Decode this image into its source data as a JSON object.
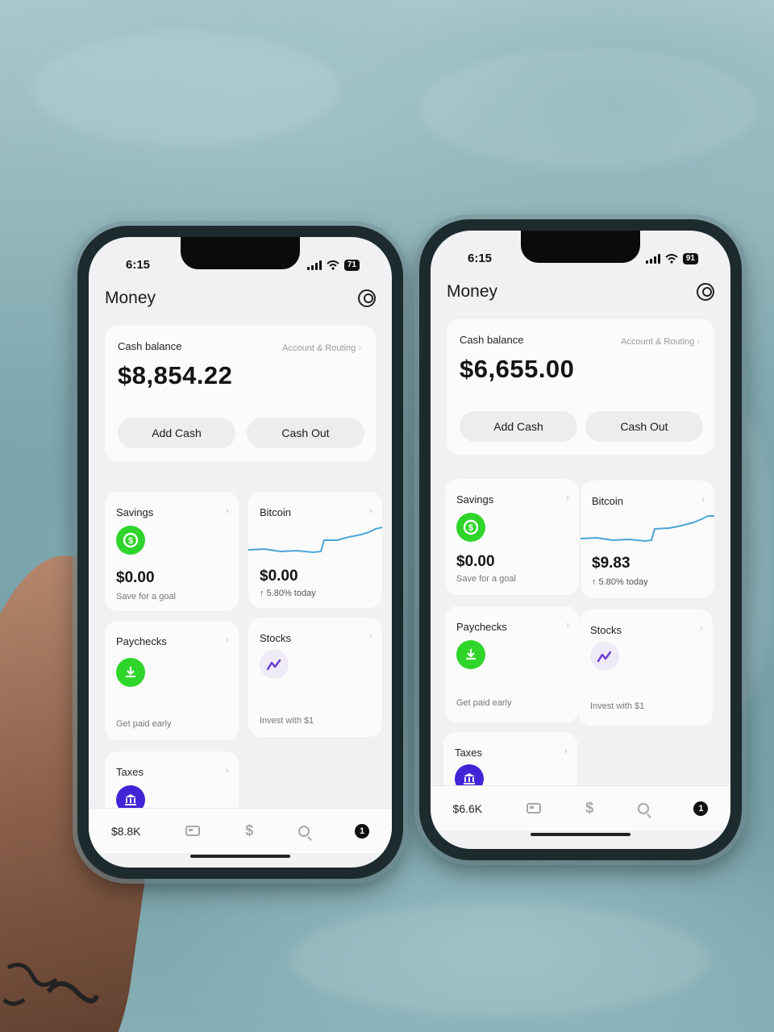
{
  "phones": [
    {
      "status": {
        "time": "6:15",
        "battery": "71"
      },
      "header": {
        "title": "Money"
      },
      "cash": {
        "label": "Cash balance",
        "account_link": "Account & Routing",
        "amount": "$8,854.22",
        "add_label": "Add Cash",
        "out_label": "Cash Out"
      },
      "savings": {
        "title": "Savings",
        "amount": "$0.00",
        "subtitle": "Save for a goal"
      },
      "bitcoin": {
        "title": "Bitcoin",
        "amount": "$0.00",
        "change": "↑ 5.80% today"
      },
      "paychecks": {
        "title": "Paychecks",
        "subtitle": "Get paid early"
      },
      "stocks": {
        "title": "Stocks",
        "subtitle": "Invest with $1"
      },
      "taxes": {
        "title": "Taxes"
      },
      "tabbar": {
        "balance": "$8.8K",
        "dollar": "$",
        "activity_count": "1"
      }
    },
    {
      "status": {
        "time": "6:15",
        "battery": "91"
      },
      "header": {
        "title": "Money"
      },
      "cash": {
        "label": "Cash balance",
        "account_link": "Account & Routing",
        "amount": "$6,655.00",
        "add_label": "Add Cash",
        "out_label": "Cash Out"
      },
      "savings": {
        "title": "Savings",
        "amount": "$0.00",
        "subtitle": "Save for a goal"
      },
      "bitcoin": {
        "title": "Bitcoin",
        "amount": "$9.83",
        "change": "↑ 5.80% today"
      },
      "paychecks": {
        "title": "Paychecks",
        "subtitle": "Get paid early"
      },
      "stocks": {
        "title": "Stocks",
        "subtitle": "Invest with $1"
      },
      "taxes": {
        "title": "Taxes"
      },
      "tabbar": {
        "balance": "$6.6K",
        "dollar": "$",
        "activity_count": "1"
      }
    }
  ],
  "colors": {
    "green": "#2fd52a",
    "bitcoin_line": "#4aa6d8",
    "stocks_purple": "#6c3bd1",
    "taxes_blue": "#4025d6"
  },
  "icons": {
    "savings": "savings-icon",
    "paychecks": "download-icon",
    "stocks": "trend-icon",
    "taxes": "bank-icon",
    "profile": "profile-icon"
  }
}
